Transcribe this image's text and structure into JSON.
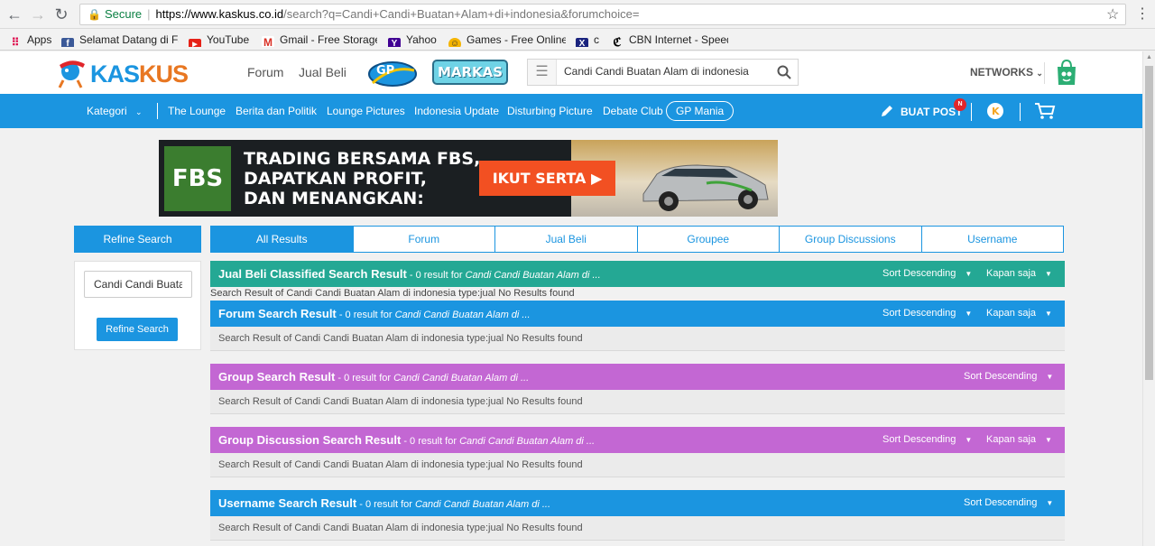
{
  "browser": {
    "secure_label": "Secure",
    "url_host": "https://www.kaskus.co.id",
    "url_path": "/search?q=Candi+Candi+Buatan+Alam+di+indonesia&forumchoice=",
    "bookmarks": [
      {
        "label": "Apps",
        "icon": "apps-grid-icon"
      },
      {
        "label": "Selamat Datang di Fa",
        "icon": "facebook-icon"
      },
      {
        "label": "YouTube",
        "icon": "youtube-icon"
      },
      {
        "label": "Gmail - Free Storage",
        "icon": "gmail-icon"
      },
      {
        "label": "Yahoo",
        "icon": "yahoo-icon"
      },
      {
        "label": "Games - Free Online",
        "icon": "games-icon"
      },
      {
        "label": "c",
        "icon": "x-icon"
      },
      {
        "label": "CBN Internet - Speed",
        "icon": "cbn-icon"
      }
    ]
  },
  "header": {
    "logo_text": "KASKUS",
    "links": [
      "Forum",
      "Jual Beli"
    ],
    "gp_badge": "GP",
    "markas_badge": "MARKAS",
    "search_value": "Candi Candi Buatan Alam di indonesia",
    "networks_label": "NETWORKS"
  },
  "navbar": {
    "kategori": "Kategori",
    "items": [
      "The Lounge",
      "Berita dan Politik",
      "Lounge Pictures",
      "Indonesia Update",
      "Disturbing Picture",
      "Debate Club"
    ],
    "pill": "GP Mania",
    "buat_post": "BUAT POST",
    "notif": "N"
  },
  "banner": {
    "logo": "FBS",
    "line1": "TRADING BERSAMA FBS,",
    "line2": "DAPATKAN PROFIT,",
    "line3": "DAN MENANGKAN:",
    "cta": "IKUT SERTA"
  },
  "refine": {
    "header": "Refine Search",
    "input_value": "Candi Candi Buatan Alam di indonesia",
    "button": "Refine Search"
  },
  "tabs": [
    "All Results",
    "Forum",
    "Jual Beli",
    "Groupee",
    "Group Discussions",
    "Username"
  ],
  "sections": [
    {
      "title": "Jual Beli Classified Search Result",
      "meta": " - 0 result for ",
      "query": "Candi Candi Buatan Alam di ...",
      "sort": "Sort Descending",
      "time": "Kapan saja",
      "body": "Search Result of Candi Candi Buatan Alam di indonesia type:jual No Results found"
    },
    {
      "title": "Forum Search Result",
      "meta": " - 0 result for ",
      "query": "Candi Candi Buatan Alam di ...",
      "sort": "Sort Descending",
      "time": "Kapan saja",
      "body": "Search Result of Candi Candi Buatan Alam di indonesia type:jual No Results found"
    },
    {
      "title": "Group Search Result",
      "meta": " - 0 result for ",
      "query": "Candi Candi Buatan Alam di ...",
      "sort": "Sort Descending",
      "body": "Search Result of Candi Candi Buatan Alam di indonesia type:jual No Results found"
    },
    {
      "title": "Group Discussion Search Result",
      "meta": " - 0 result for ",
      "query": "Candi Candi Buatan Alam di ...",
      "sort": "Sort Descending",
      "time": "Kapan saja",
      "body": "Search Result of Candi Candi Buatan Alam di indonesia type:jual No Results found"
    },
    {
      "title": "Username Search Result",
      "meta": " - 0 result for ",
      "query": "Candi Candi Buatan Alam di ...",
      "sort": "Sort Descending",
      "body": "Search Result of Candi Candi Buatan Alam di indonesia type:jual No Results found"
    }
  ],
  "colors": {
    "primary": "#1b95e0",
    "teal": "#24a894",
    "purple": "#c367d3"
  }
}
